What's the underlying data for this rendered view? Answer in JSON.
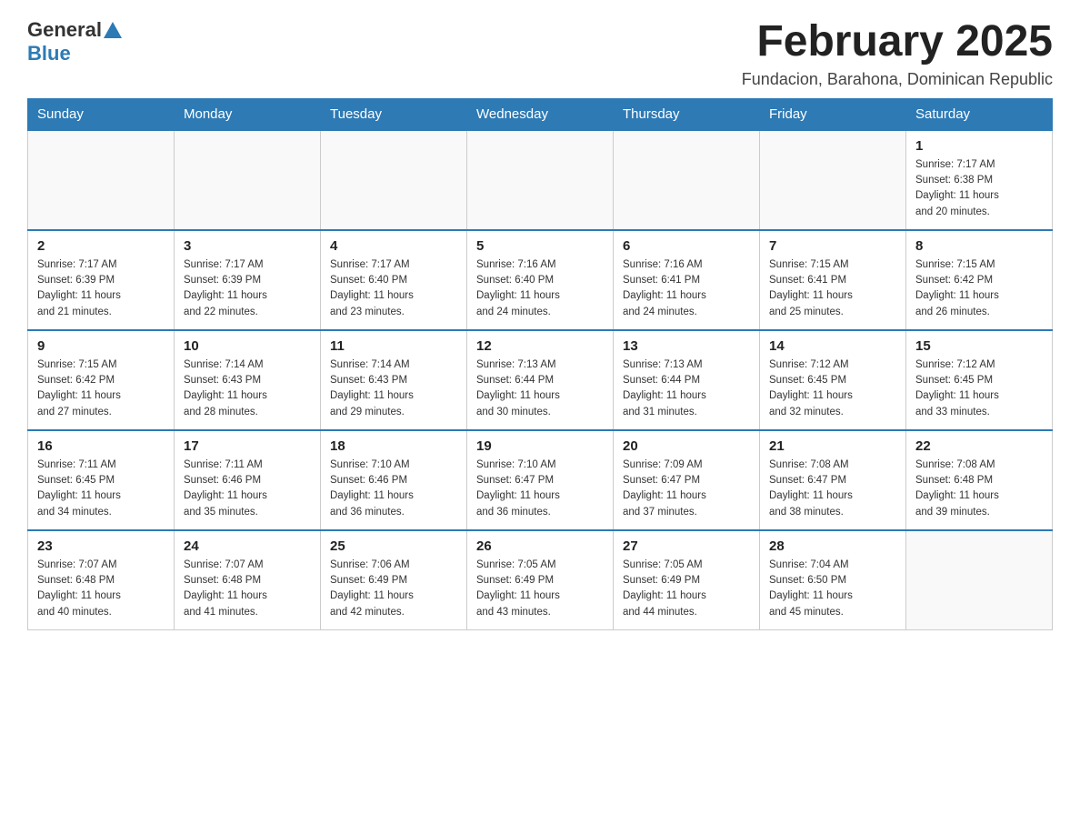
{
  "header": {
    "logo_general": "General",
    "logo_blue": "Blue",
    "month_title": "February 2025",
    "location": "Fundacion, Barahona, Dominican Republic"
  },
  "days_of_week": [
    "Sunday",
    "Monday",
    "Tuesday",
    "Wednesday",
    "Thursday",
    "Friday",
    "Saturday"
  ],
  "weeks": [
    [
      {
        "day": "",
        "info": ""
      },
      {
        "day": "",
        "info": ""
      },
      {
        "day": "",
        "info": ""
      },
      {
        "day": "",
        "info": ""
      },
      {
        "day": "",
        "info": ""
      },
      {
        "day": "",
        "info": ""
      },
      {
        "day": "1",
        "info": "Sunrise: 7:17 AM\nSunset: 6:38 PM\nDaylight: 11 hours\nand 20 minutes."
      }
    ],
    [
      {
        "day": "2",
        "info": "Sunrise: 7:17 AM\nSunset: 6:39 PM\nDaylight: 11 hours\nand 21 minutes."
      },
      {
        "day": "3",
        "info": "Sunrise: 7:17 AM\nSunset: 6:39 PM\nDaylight: 11 hours\nand 22 minutes."
      },
      {
        "day": "4",
        "info": "Sunrise: 7:17 AM\nSunset: 6:40 PM\nDaylight: 11 hours\nand 23 minutes."
      },
      {
        "day": "5",
        "info": "Sunrise: 7:16 AM\nSunset: 6:40 PM\nDaylight: 11 hours\nand 24 minutes."
      },
      {
        "day": "6",
        "info": "Sunrise: 7:16 AM\nSunset: 6:41 PM\nDaylight: 11 hours\nand 24 minutes."
      },
      {
        "day": "7",
        "info": "Sunrise: 7:15 AM\nSunset: 6:41 PM\nDaylight: 11 hours\nand 25 minutes."
      },
      {
        "day": "8",
        "info": "Sunrise: 7:15 AM\nSunset: 6:42 PM\nDaylight: 11 hours\nand 26 minutes."
      }
    ],
    [
      {
        "day": "9",
        "info": "Sunrise: 7:15 AM\nSunset: 6:42 PM\nDaylight: 11 hours\nand 27 minutes."
      },
      {
        "day": "10",
        "info": "Sunrise: 7:14 AM\nSunset: 6:43 PM\nDaylight: 11 hours\nand 28 minutes."
      },
      {
        "day": "11",
        "info": "Sunrise: 7:14 AM\nSunset: 6:43 PM\nDaylight: 11 hours\nand 29 minutes."
      },
      {
        "day": "12",
        "info": "Sunrise: 7:13 AM\nSunset: 6:44 PM\nDaylight: 11 hours\nand 30 minutes."
      },
      {
        "day": "13",
        "info": "Sunrise: 7:13 AM\nSunset: 6:44 PM\nDaylight: 11 hours\nand 31 minutes."
      },
      {
        "day": "14",
        "info": "Sunrise: 7:12 AM\nSunset: 6:45 PM\nDaylight: 11 hours\nand 32 minutes."
      },
      {
        "day": "15",
        "info": "Sunrise: 7:12 AM\nSunset: 6:45 PM\nDaylight: 11 hours\nand 33 minutes."
      }
    ],
    [
      {
        "day": "16",
        "info": "Sunrise: 7:11 AM\nSunset: 6:45 PM\nDaylight: 11 hours\nand 34 minutes."
      },
      {
        "day": "17",
        "info": "Sunrise: 7:11 AM\nSunset: 6:46 PM\nDaylight: 11 hours\nand 35 minutes."
      },
      {
        "day": "18",
        "info": "Sunrise: 7:10 AM\nSunset: 6:46 PM\nDaylight: 11 hours\nand 36 minutes."
      },
      {
        "day": "19",
        "info": "Sunrise: 7:10 AM\nSunset: 6:47 PM\nDaylight: 11 hours\nand 36 minutes."
      },
      {
        "day": "20",
        "info": "Sunrise: 7:09 AM\nSunset: 6:47 PM\nDaylight: 11 hours\nand 37 minutes."
      },
      {
        "day": "21",
        "info": "Sunrise: 7:08 AM\nSunset: 6:47 PM\nDaylight: 11 hours\nand 38 minutes."
      },
      {
        "day": "22",
        "info": "Sunrise: 7:08 AM\nSunset: 6:48 PM\nDaylight: 11 hours\nand 39 minutes."
      }
    ],
    [
      {
        "day": "23",
        "info": "Sunrise: 7:07 AM\nSunset: 6:48 PM\nDaylight: 11 hours\nand 40 minutes."
      },
      {
        "day": "24",
        "info": "Sunrise: 7:07 AM\nSunset: 6:48 PM\nDaylight: 11 hours\nand 41 minutes."
      },
      {
        "day": "25",
        "info": "Sunrise: 7:06 AM\nSunset: 6:49 PM\nDaylight: 11 hours\nand 42 minutes."
      },
      {
        "day": "26",
        "info": "Sunrise: 7:05 AM\nSunset: 6:49 PM\nDaylight: 11 hours\nand 43 minutes."
      },
      {
        "day": "27",
        "info": "Sunrise: 7:05 AM\nSunset: 6:49 PM\nDaylight: 11 hours\nand 44 minutes."
      },
      {
        "day": "28",
        "info": "Sunrise: 7:04 AM\nSunset: 6:50 PM\nDaylight: 11 hours\nand 45 minutes."
      },
      {
        "day": "",
        "info": ""
      }
    ]
  ]
}
